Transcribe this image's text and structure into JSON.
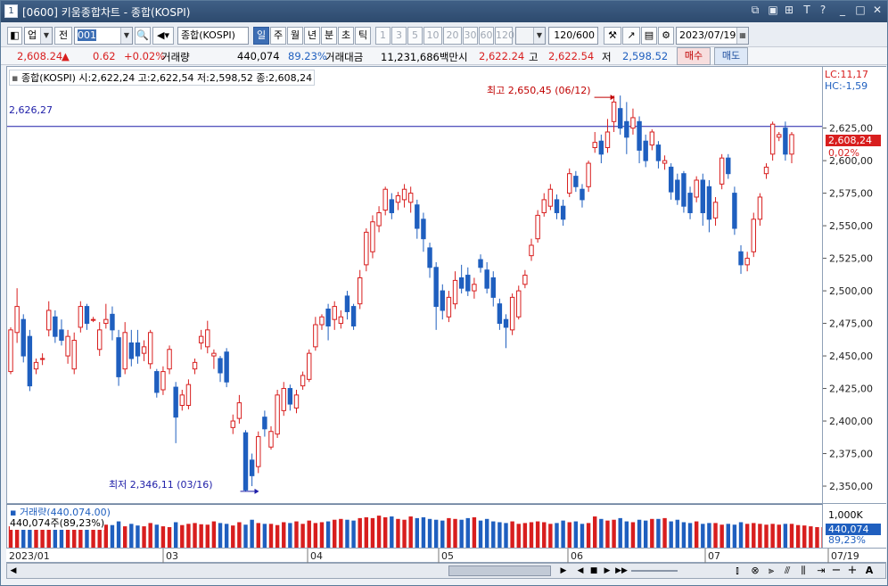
{
  "window": {
    "title": "[0600] 키움종합차트 - 종합(KOSPI)",
    "number": "1"
  },
  "toolbar": {
    "market": "업",
    "prev_label": "전",
    "code": "001",
    "name": "종합(KOSPI)",
    "periods": [
      "일",
      "주",
      "월",
      "년",
      "분",
      "초",
      "틱"
    ],
    "selected_period": "일",
    "intervals": [
      "1",
      "3",
      "5",
      "10",
      "20",
      "30",
      "60",
      "120"
    ],
    "count": "120/600",
    "date": "2023/07/19"
  },
  "quote": {
    "price": "2,608.24",
    "arrow": "▲",
    "change": "0.62",
    "change_pct": "+0.02%",
    "volume_label": "거래량",
    "volume": "440,074",
    "volume_pct": "89.23%",
    "amount_label": "거래대금",
    "amount": "11,231,686백만",
    "open_label": "시",
    "open": "2,622.24",
    "high_label": "고",
    "high": "2,622.54",
    "low_label": "저",
    "low": "2,598.52",
    "buy": "매수",
    "sell": "매도"
  },
  "chart": {
    "legend": "종합(KOSPI) 시:2,622,24 고:2,622,54 저:2,598,52 종:2,608,24",
    "lc": "LC:11,17",
    "hc": "HC:-1,59",
    "hline_label": "2,626,27",
    "high_annot": "최고 2,650,45 (06/12)",
    "low_annot": "최저 2,346,11 (03/16)",
    "current_tag": "2,608,24",
    "current_pct": "0,02%",
    "volume_legend": "거래량(440,074,00)",
    "volume_sub": "440,074주(89,23%)",
    "volume_axis_top": "1,000K",
    "volume_tag": "440,074",
    "volume_tag_pct": "89,23%",
    "colors": {
      "up": "#d81e1e",
      "down": "#1f5fbf",
      "hline": "#1e1ea8",
      "annot": "#c00000"
    }
  },
  "chart_data": {
    "type": "candlestick",
    "title": "종합(KOSPI)",
    "y_ticks": [
      "2,625,00",
      "2,600,00",
      "2,575,00",
      "2,550,00",
      "2,525,00",
      "2,500,00",
      "2,475,00",
      "2,450,00",
      "2,425,00",
      "2,400,00",
      "2,375,00",
      "2,350,00"
    ],
    "x_ticks": [
      "2023/01",
      "03",
      "04",
      "05",
      "06",
      "07",
      "07/19"
    ],
    "ylim": [
      2337,
      2672
    ],
    "candles": [
      {
        "o": 2438,
        "c": 2470,
        "h": 2472,
        "l": 2436
      },
      {
        "o": 2468,
        "c": 2488,
        "h": 2502,
        "l": 2460
      },
      {
        "o": 2478,
        "c": 2450,
        "h": 2482,
        "l": 2445
      },
      {
        "o": 2465,
        "c": 2427,
        "h": 2470,
        "l": 2423
      },
      {
        "o": 2440,
        "c": 2445,
        "h": 2448,
        "l": 2436
      },
      {
        "o": 2448,
        "c": 2448,
        "h": 2452,
        "l": 2443
      },
      {
        "o": 2470,
        "c": 2485,
        "h": 2492,
        "l": 2465
      },
      {
        "o": 2480,
        "c": 2465,
        "h": 2485,
        "l": 2460
      },
      {
        "o": 2470,
        "c": 2462,
        "h": 2478,
        "l": 2458
      },
      {
        "o": 2450,
        "c": 2465,
        "h": 2470,
        "l": 2444
      },
      {
        "o": 2440,
        "c": 2462,
        "h": 2468,
        "l": 2436
      },
      {
        "o": 2472,
        "c": 2488,
        "h": 2492,
        "l": 2468
      },
      {
        "o": 2488,
        "c": 2475,
        "h": 2490,
        "l": 2470
      },
      {
        "o": 2478,
        "c": 2478,
        "h": 2480,
        "l": 2476
      },
      {
        "o": 2455,
        "c": 2470,
        "h": 2476,
        "l": 2450
      },
      {
        "o": 2475,
        "c": 2478,
        "h": 2490,
        "l": 2471
      },
      {
        "o": 2482,
        "c": 2470,
        "h": 2488,
        "l": 2462
      },
      {
        "o": 2464,
        "c": 2434,
        "h": 2470,
        "l": 2427
      },
      {
        "o": 2440,
        "c": 2468,
        "h": 2476,
        "l": 2436
      },
      {
        "o": 2460,
        "c": 2448,
        "h": 2470,
        "l": 2442
      },
      {
        "o": 2460,
        "c": 2450,
        "h": 2470,
        "l": 2444
      },
      {
        "o": 2452,
        "c": 2457,
        "h": 2462,
        "l": 2446
      },
      {
        "o": 2444,
        "c": 2468,
        "h": 2470,
        "l": 2440
      },
      {
        "o": 2438,
        "c": 2422,
        "h": 2440,
        "l": 2418
      },
      {
        "o": 2424,
        "c": 2438,
        "h": 2442,
        "l": 2420
      },
      {
        "o": 2440,
        "c": 2455,
        "h": 2458,
        "l": 2436
      },
      {
        "o": 2426,
        "c": 2403,
        "h": 2430,
        "l": 2383
      },
      {
        "o": 2412,
        "c": 2420,
        "h": 2424,
        "l": 2408
      },
      {
        "o": 2412,
        "c": 2428,
        "h": 2432,
        "l": 2409
      },
      {
        "o": 2440,
        "c": 2445,
        "h": 2448,
        "l": 2436
      },
      {
        "o": 2460,
        "c": 2465,
        "h": 2470,
        "l": 2455
      },
      {
        "o": 2457,
        "c": 2470,
        "h": 2477,
        "l": 2452
      },
      {
        "o": 2450,
        "c": 2452,
        "h": 2455,
        "l": 2440
      },
      {
        "o": 2448,
        "c": 2437,
        "h": 2450,
        "l": 2430
      },
      {
        "o": 2453,
        "c": 2430,
        "h": 2456,
        "l": 2426
      },
      {
        "o": 2395,
        "c": 2400,
        "h": 2405,
        "l": 2390
      },
      {
        "o": 2402,
        "c": 2414,
        "h": 2420,
        "l": 2398
      },
      {
        "o": 2391,
        "c": 2347,
        "h": 2393,
        "l": 2346
      },
      {
        "o": 2370,
        "c": 2358,
        "h": 2375,
        "l": 2350
      },
      {
        "o": 2365,
        "c": 2388,
        "h": 2392,
        "l": 2360
      },
      {
        "o": 2403,
        "c": 2394,
        "h": 2408,
        "l": 2388
      },
      {
        "o": 2380,
        "c": 2392,
        "h": 2396,
        "l": 2378
      },
      {
        "o": 2390,
        "c": 2420,
        "h": 2424,
        "l": 2387
      },
      {
        "o": 2408,
        "c": 2425,
        "h": 2430,
        "l": 2404
      },
      {
        "o": 2425,
        "c": 2413,
        "h": 2428,
        "l": 2408
      },
      {
        "o": 2410,
        "c": 2420,
        "h": 2424,
        "l": 2406
      },
      {
        "o": 2427,
        "c": 2435,
        "h": 2438,
        "l": 2424
      },
      {
        "o": 2432,
        "c": 2452,
        "h": 2455,
        "l": 2430
      },
      {
        "o": 2457,
        "c": 2474,
        "h": 2480,
        "l": 2454
      },
      {
        "o": 2474,
        "c": 2480,
        "h": 2482,
        "l": 2470
      },
      {
        "o": 2486,
        "c": 2473,
        "h": 2490,
        "l": 2462
      },
      {
        "o": 2478,
        "c": 2488,
        "h": 2492,
        "l": 2470
      },
      {
        "o": 2475,
        "c": 2480,
        "h": 2485,
        "l": 2471
      },
      {
        "o": 2496,
        "c": 2484,
        "h": 2500,
        "l": 2478
      },
      {
        "o": 2488,
        "c": 2473,
        "h": 2490,
        "l": 2470
      },
      {
        "o": 2490,
        "c": 2510,
        "h": 2516,
        "l": 2486
      },
      {
        "o": 2520,
        "c": 2545,
        "h": 2548,
        "l": 2515
      },
      {
        "o": 2530,
        "c": 2553,
        "h": 2558,
        "l": 2525
      },
      {
        "o": 2550,
        "c": 2560,
        "h": 2565,
        "l": 2545
      },
      {
        "o": 2562,
        "c": 2578,
        "h": 2580,
        "l": 2558
      },
      {
        "o": 2570,
        "c": 2560,
        "h": 2575,
        "l": 2555
      },
      {
        "o": 2568,
        "c": 2573,
        "h": 2576,
        "l": 2562
      },
      {
        "o": 2570,
        "c": 2578,
        "h": 2582,
        "l": 2564
      },
      {
        "o": 2568,
        "c": 2575,
        "h": 2580,
        "l": 2560
      },
      {
        "o": 2566,
        "c": 2548,
        "h": 2570,
        "l": 2540
      },
      {
        "o": 2555,
        "c": 2540,
        "h": 2560,
        "l": 2530
      },
      {
        "o": 2533,
        "c": 2518,
        "h": 2537,
        "l": 2510
      },
      {
        "o": 2518,
        "c": 2488,
        "h": 2522,
        "l": 2470
      },
      {
        "o": 2500,
        "c": 2485,
        "h": 2505,
        "l": 2478
      },
      {
        "o": 2480,
        "c": 2495,
        "h": 2500,
        "l": 2476
      },
      {
        "o": 2490,
        "c": 2508,
        "h": 2515,
        "l": 2486
      },
      {
        "o": 2510,
        "c": 2502,
        "h": 2520,
        "l": 2498
      },
      {
        "o": 2512,
        "c": 2500,
        "h": 2518,
        "l": 2496
      },
      {
        "o": 2500,
        "c": 2505,
        "h": 2510,
        "l": 2494
      },
      {
        "o": 2524,
        "c": 2518,
        "h": 2528,
        "l": 2514
      },
      {
        "o": 2516,
        "c": 2502,
        "h": 2522,
        "l": 2498
      },
      {
        "o": 2510,
        "c": 2495,
        "h": 2515,
        "l": 2488
      },
      {
        "o": 2490,
        "c": 2475,
        "h": 2494,
        "l": 2470
      },
      {
        "o": 2478,
        "c": 2472,
        "h": 2482,
        "l": 2456
      },
      {
        "o": 2470,
        "c": 2495,
        "h": 2498,
        "l": 2466
      },
      {
        "o": 2480,
        "c": 2500,
        "h": 2504,
        "l": 2478
      },
      {
        "o": 2505,
        "c": 2512,
        "h": 2516,
        "l": 2502
      },
      {
        "o": 2527,
        "c": 2535,
        "h": 2540,
        "l": 2523
      },
      {
        "o": 2540,
        "c": 2558,
        "h": 2562,
        "l": 2537
      },
      {
        "o": 2560,
        "c": 2570,
        "h": 2575,
        "l": 2557
      },
      {
        "o": 2565,
        "c": 2578,
        "h": 2582,
        "l": 2562
      },
      {
        "o": 2570,
        "c": 2560,
        "h": 2574,
        "l": 2555
      },
      {
        "o": 2565,
        "c": 2555,
        "h": 2570,
        "l": 2550
      },
      {
        "o": 2575,
        "c": 2590,
        "h": 2594,
        "l": 2572
      },
      {
        "o": 2588,
        "c": 2580,
        "h": 2592,
        "l": 2576
      },
      {
        "o": 2578,
        "c": 2570,
        "h": 2582,
        "l": 2564
      },
      {
        "o": 2580,
        "c": 2598,
        "h": 2600,
        "l": 2576
      },
      {
        "o": 2610,
        "c": 2614,
        "h": 2622,
        "l": 2606
      },
      {
        "o": 2615,
        "c": 2605,
        "h": 2620,
        "l": 2598
      },
      {
        "o": 2610,
        "c": 2622,
        "h": 2632,
        "l": 2606
      },
      {
        "o": 2630,
        "c": 2645,
        "h": 2650,
        "l": 2622
      },
      {
        "o": 2640,
        "c": 2625,
        "h": 2650,
        "l": 2620
      },
      {
        "o": 2630,
        "c": 2618,
        "h": 2645,
        "l": 2605
      },
      {
        "o": 2625,
        "c": 2633,
        "h": 2640,
        "l": 2620
      },
      {
        "o": 2630,
        "c": 2608,
        "h": 2634,
        "l": 2598
      },
      {
        "o": 2615,
        "c": 2600,
        "h": 2620,
        "l": 2595
      },
      {
        "o": 2612,
        "c": 2622,
        "h": 2624,
        "l": 2608
      },
      {
        "o": 2612,
        "c": 2600,
        "h": 2615,
        "l": 2594
      },
      {
        "o": 2598,
        "c": 2600,
        "h": 2604,
        "l": 2593
      },
      {
        "o": 2595,
        "c": 2576,
        "h": 2598,
        "l": 2570
      },
      {
        "o": 2585,
        "c": 2570,
        "h": 2590,
        "l": 2566
      },
      {
        "o": 2590,
        "c": 2565,
        "h": 2592,
        "l": 2560
      },
      {
        "o": 2575,
        "c": 2560,
        "h": 2580,
        "l": 2555
      },
      {
        "o": 2572,
        "c": 2585,
        "h": 2588,
        "l": 2568
      },
      {
        "o": 2585,
        "c": 2560,
        "h": 2590,
        "l": 2550
      },
      {
        "o": 2580,
        "c": 2555,
        "h": 2585,
        "l": 2545
      },
      {
        "o": 2556,
        "c": 2568,
        "h": 2572,
        "l": 2550
      },
      {
        "o": 2582,
        "c": 2602,
        "h": 2605,
        "l": 2578
      },
      {
        "o": 2602,
        "c": 2590,
        "h": 2605,
        "l": 2586
      },
      {
        "o": 2575,
        "c": 2548,
        "h": 2580,
        "l": 2543
      },
      {
        "o": 2530,
        "c": 2520,
        "h": 2535,
        "l": 2513
      },
      {
        "o": 2520,
        "c": 2525,
        "h": 2530,
        "l": 2515
      },
      {
        "o": 2530,
        "c": 2555,
        "h": 2560,
        "l": 2526
      },
      {
        "o": 2555,
        "c": 2572,
        "h": 2575,
        "l": 2550
      },
      {
        "o": 2590,
        "c": 2595,
        "h": 2598,
        "l": 2586
      },
      {
        "o": 2605,
        "c": 2628,
        "h": 2630,
        "l": 2600
      },
      {
        "o": 2618,
        "c": 2620,
        "h": 2622,
        "l": 2615
      },
      {
        "o": 2625,
        "c": 2605,
        "h": 2630,
        "l": 2600
      },
      {
        "o": 2605,
        "c": 2620,
        "h": 2622,
        "l": 2598
      }
    ],
    "volume": [
      52,
      66,
      60,
      48,
      52,
      58,
      55,
      50,
      52,
      54,
      51,
      56,
      60,
      58,
      62,
      56,
      55,
      64,
      52,
      58,
      54,
      52,
      60,
      56,
      52,
      50,
      62,
      55,
      58,
      60,
      57,
      56,
      64,
      60,
      58,
      54,
      62,
      56,
      68,
      60,
      58,
      58,
      55,
      62,
      60,
      64,
      58,
      66,
      60,
      62,
      64,
      68,
      70,
      68,
      66,
      72,
      74,
      72,
      78,
      74,
      76,
      70,
      68,
      76,
      72,
      74,
      70,
      68,
      66,
      72,
      70,
      68,
      72,
      74,
      66,
      70,
      64,
      62,
      60,
      64,
      58,
      60,
      62,
      64,
      62,
      58,
      60,
      66,
      62,
      64,
      58,
      60,
      76,
      70,
      66,
      68,
      72,
      64,
      62,
      68,
      66,
      70,
      70,
      72,
      64,
      68,
      62,
      60,
      64,
      58,
      60,
      60,
      56,
      58,
      56,
      62,
      58,
      60,
      58,
      56,
      58,
      56,
      58,
      58,
      55,
      54,
      52,
      50,
      50,
      48
    ]
  }
}
